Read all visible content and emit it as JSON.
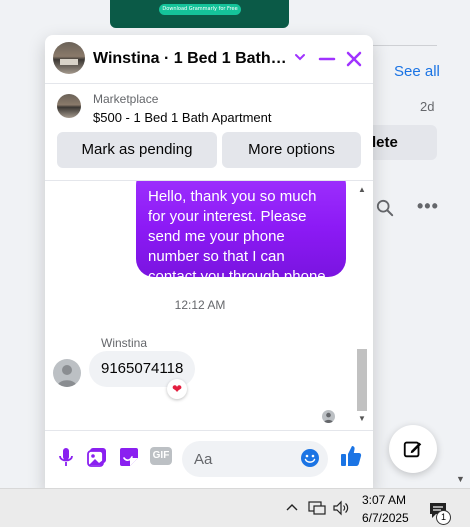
{
  "background": {
    "promo_button": "Download Grammarly for Free",
    "see_all": "See all",
    "age": "2d",
    "delete_label": "lete",
    "more_label": "•••"
  },
  "chat": {
    "title": "Winstina · 1 Bed 1 Bath Ap...",
    "marketplace_label": "Marketplace",
    "listing": "$500 - 1 Bed 1 Bath Apartment",
    "buttons": {
      "mark_pending": "Mark as pending",
      "more_options": "More options"
    },
    "messages": {
      "outgoing": "Hello, thank you so much for your interest. Please send me your phone number so that I can contact you through phone",
      "timestamp": "12:12 AM",
      "sender": "Winstina",
      "incoming": "9165074118",
      "reaction": "❤"
    },
    "composer": {
      "placeholder": "Aa",
      "gif_label": "GIF"
    },
    "accent_color": "#a033ff",
    "icon_color": "#1b74e4"
  },
  "taskbar": {
    "time": "3:07 AM",
    "date": "6/7/2025",
    "notification_count": "1"
  }
}
